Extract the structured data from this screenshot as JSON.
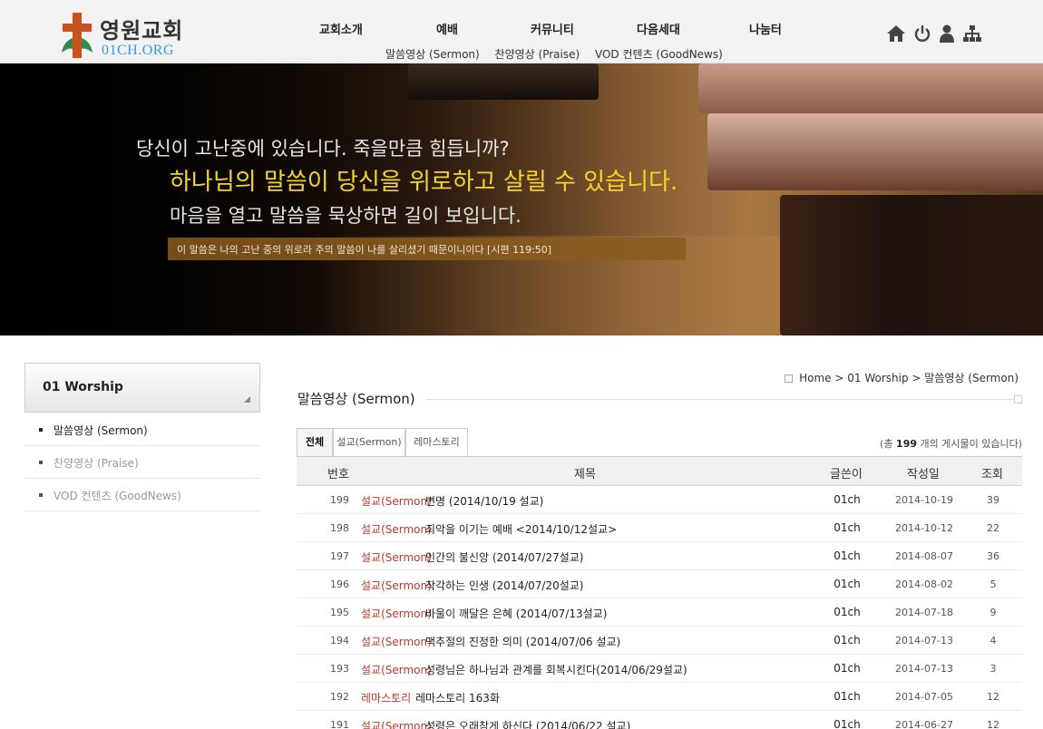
{
  "header": {
    "logo_name": "영원교회",
    "logo_domain": "01CH.ORG",
    "menu": [
      "교회소개",
      "예배",
      "커뮤니티",
      "다음세대",
      "나눔터"
    ],
    "submenu": [
      "말씀영상 (Sermon)",
      "찬양영상 (Praise)",
      "VOD 컨텐츠 (GoodNews)"
    ],
    "util_icons": [
      "home-icon",
      "power-icon",
      "user-icon",
      "sitemap-icon"
    ]
  },
  "banner": {
    "line1": "당신이 고난중에 있습니다. 죽을만큼 힘듭니까?",
    "line2": "하나님의 말씀이 당신을 위로하고 살릴 수 있습니다.",
    "line3": "마음을 열고 말씀을 묵상하면 길이 보입니다.",
    "verse": "이 말씀은 나의 고난 중의 위로라 주의 말씀이 나를 살리셨기 때문이니이다 [시편 119:50]"
  },
  "sidebar": {
    "title": "01 Worship",
    "items": [
      {
        "label": "말씀영상 (Sermon)",
        "active": true
      },
      {
        "label": "찬양영상 (Praise)",
        "active": false
      },
      {
        "label": "VOD 컨텐츠 (GoodNews)",
        "active": false
      }
    ]
  },
  "location": {
    "home": "Home",
    "sep": ">",
    "section": "01 Worship",
    "current": "말씀영상 (Sermon)"
  },
  "page_title": "말씀영상 (Sermon)",
  "tabs": [
    "전체",
    "설교(Sermon)",
    "레마스토리"
  ],
  "total": {
    "prefix": "(총",
    "count": "199",
    "suffix": "개의 게시물이 있습니다)"
  },
  "table": {
    "columns": [
      "번호",
      "제목",
      "글쓴이",
      "작성일",
      "조회"
    ],
    "rows": [
      {
        "no": "199",
        "cat": "설교(Sermon)",
        "subject": "변명 (2014/10/19 설교)",
        "writer": "01ch",
        "date": "2014-10-19",
        "hits": "39"
      },
      {
        "no": "198",
        "cat": "설교(Sermon)",
        "subject": "죄악을 이기는 예배 <2014/10/12설교>",
        "writer": "01ch",
        "date": "2014-10-12",
        "hits": "22"
      },
      {
        "no": "197",
        "cat": "설교(Sermon)",
        "subject": "인간의 불신앙 (2014/07/27설교)",
        "writer": "01ch",
        "date": "2014-08-07",
        "hits": "36"
      },
      {
        "no": "196",
        "cat": "설교(Sermon)",
        "subject": "착각하는 인생 (2014/07/20설교)",
        "writer": "01ch",
        "date": "2014-08-02",
        "hits": "5"
      },
      {
        "no": "195",
        "cat": "설교(Sermon)",
        "subject": "바울이 깨달은 은혜 (2014/07/13설교)",
        "writer": "01ch",
        "date": "2014-07-18",
        "hits": "9"
      },
      {
        "no": "194",
        "cat": "설교(Sermon)",
        "subject": "맥추절의 진정한 의미 (2014/07/06 설교)",
        "writer": "01ch",
        "date": "2014-07-13",
        "hits": "4"
      },
      {
        "no": "193",
        "cat": "설교(Sermon)",
        "subject": "성령님은 하나님과 관계를 회복시킨다(2014/06/29설교)",
        "writer": "01ch",
        "date": "2014-07-13",
        "hits": "3"
      },
      {
        "no": "192",
        "cat": "레마스토리",
        "subject": "레마스토리 163화",
        "writer": "01ch",
        "date": "2014-07-05",
        "hits": "12"
      },
      {
        "no": "191",
        "cat": "설교(Sermon)",
        "subject": "성령은 오래참게 하신다 (2014/06/22 설교)",
        "writer": "01ch",
        "date": "2014-06-27",
        "hits": "12"
      }
    ]
  },
  "colors": {
    "accent_yellow": "#f5d42c",
    "category_red": "#c0392b",
    "verse_bar": "#8b5c1e"
  }
}
